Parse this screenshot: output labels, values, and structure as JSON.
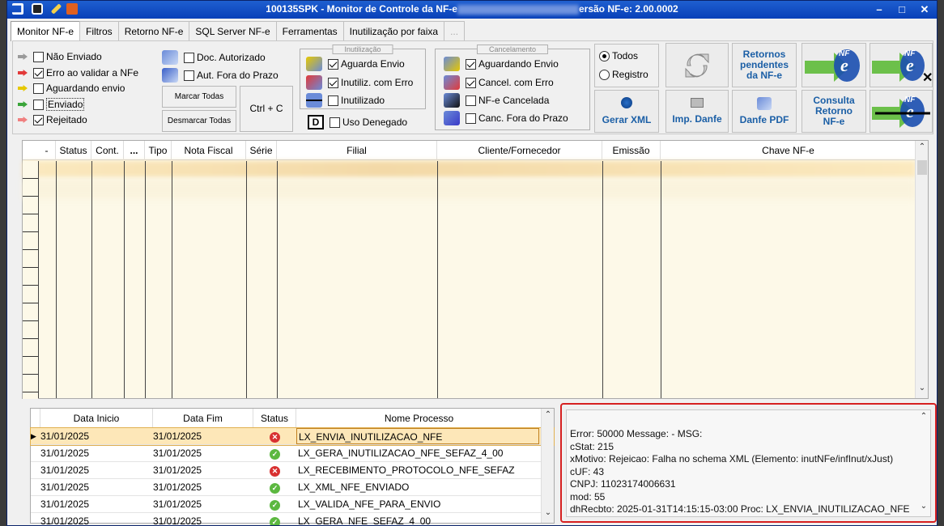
{
  "window": {
    "title_left": "100135SPK - Monitor de Controle da NF-e",
    "title_right": "ersão NF-e: 2.00.0002",
    "controls": [
      "–",
      "□",
      "✕"
    ]
  },
  "tabs": [
    {
      "label": "Monitor NF-e"
    },
    {
      "label": "Filtros"
    },
    {
      "label": "Retorno NF-e"
    },
    {
      "label": "SQL Server NF-e"
    },
    {
      "label": "Ferramentas"
    },
    {
      "label": "Inutilização por faixa"
    },
    {
      "label": "..."
    }
  ],
  "status_filters": [
    {
      "label": "Não Enviado",
      "checked": false,
      "color": "#9a9a9a"
    },
    {
      "label": "Erro ao validar a NFe",
      "checked": true,
      "color": "#e23a3a"
    },
    {
      "label": "Aguardando envio",
      "checked": false,
      "color": "#e6c800"
    },
    {
      "label": "Enviado",
      "checked": false,
      "color": "#3aa53a"
    },
    {
      "label": "Rejeitado",
      "checked": true,
      "color": "#e23a3a"
    }
  ],
  "auth_filters": [
    {
      "label": "Doc. Autorizado",
      "checked": false
    },
    {
      "label": "Aut. Fora do Prazo",
      "checked": false
    }
  ],
  "buttons": {
    "marcar_todas": "Marcar Todas",
    "desmarcar_todas": "Desmarcar Todas",
    "ctrl_c": "Ctrl + C"
  },
  "inutilizacao": {
    "legend": "Inutilização",
    "items": [
      {
        "label": "Aguarda Envio",
        "checked": true
      },
      {
        "label": "Inutiliz. com Erro",
        "checked": true
      },
      {
        "label": "Inutilizado",
        "checked": false
      }
    ]
  },
  "uso_denegado": {
    "label": "Uso Denegado",
    "checked": false
  },
  "cancelamento": {
    "legend": "Cancelamento",
    "items": [
      {
        "label": "Aguardando Envio",
        "checked": true
      },
      {
        "label": "Cancel. com Erro",
        "checked": true
      },
      {
        "label": "NF-e Cancelada",
        "checked": false
      },
      {
        "label": "Canc. Fora do Prazo",
        "checked": false
      }
    ]
  },
  "radio": {
    "options": [
      "Todos",
      "Registro"
    ],
    "selected": "Todos"
  },
  "action_buttons": {
    "retornos_pendentes": [
      "Retornos",
      "pendentes",
      "da NF-e"
    ],
    "gerar_xml": "Gerar XML",
    "imp_danfe": "Imp. Danfe",
    "danfe_pdf": "Danfe PDF",
    "consulta_retorno": [
      "Consulta",
      "Retorno",
      "NF-e"
    ],
    "nfe_logo": "NF"
  },
  "grid": {
    "columns": [
      "-",
      "Status",
      "Cont.",
      "...",
      "Tipo",
      "Nota Fiscal",
      "Série",
      "Filial",
      "Cliente/Fornecedor",
      "Emissão",
      "Chave NF-e"
    ]
  },
  "process_table": {
    "columns": [
      "Data Inicio",
      "Data Fim",
      "Status",
      "Nome Processo"
    ],
    "rows": [
      {
        "inicio": "31/01/2025",
        "fim": "31/01/2025",
        "status": "error",
        "nome": "LX_ENVIA_INUTILIZACAO_NFE"
      },
      {
        "inicio": "31/01/2025",
        "fim": "31/01/2025",
        "status": "ok",
        "nome": "LX_GERA_INUTILIZACAO_NFE_SEFAZ_4_00"
      },
      {
        "inicio": "31/01/2025",
        "fim": "31/01/2025",
        "status": "error",
        "nome": "LX_RECEBIMENTO_PROTOCOLO_NFE_SEFAZ"
      },
      {
        "inicio": "31/01/2025",
        "fim": "31/01/2025",
        "status": "ok",
        "nome": "LX_XML_NFE_ENVIADO"
      },
      {
        "inicio": "31/01/2025",
        "fim": "31/01/2025",
        "status": "ok",
        "nome": "LX_VALIDA_NFE_PARA_ENVIO"
      },
      {
        "inicio": "31/01/2025",
        "fim": "31/01/2025",
        "status": "ok",
        "nome": "LX_GERA_NFE_SEFAZ_4_00"
      }
    ]
  },
  "log": {
    "lines": [
      "Error: 50000 Message: - MSG:",
      "cStat: 215",
      "xMotivo: Rejeicao: Falha no schema XML (Elemento: inutNFe/infInut/xJust)",
      "cUF: 43",
      "CNPJ: 11023174006631",
      "mod: 55",
      "dhRecbto: 2025-01-31T14:15:15-03:00 Proc: LX_ENVIA_INUTILIZACAO_NFE"
    ]
  }
}
